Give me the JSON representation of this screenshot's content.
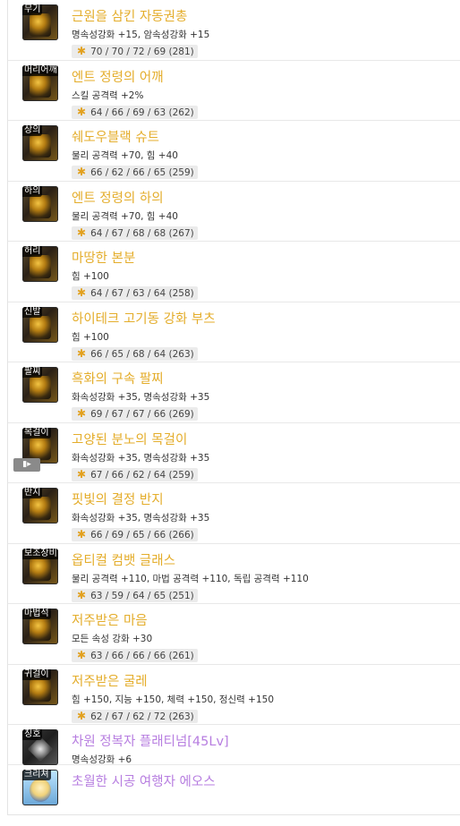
{
  "items": [
    {
      "slot": "무기",
      "name": "근원을 삼킨 자동권총",
      "option": "명속성강화 +15, 암속성강화 +15",
      "stats": "70 / 70 / 72 / 69 (281)",
      "color": "#e4ad2b",
      "icon": "pistol-icon"
    },
    {
      "slot": "머리어깨",
      "name": "엔트 정령의 어깨",
      "option": "스킬 공격력 +2%",
      "stats": "64 / 66 / 69 / 63 (262)",
      "color": "#e4ad2b",
      "icon": "shoulder-armor-icon"
    },
    {
      "slot": "상의",
      "name": "쉐도우블랙 슈트",
      "option": "물리 공격력 +70, 힘 +40",
      "stats": "66 / 62 / 66 / 65 (259)",
      "color": "#e4ad2b",
      "icon": "suit-icon"
    },
    {
      "slot": "하의",
      "name": "엔트 정령의 하의",
      "option": "물리 공격력 +70, 힘 +40",
      "stats": "64 / 67 / 68 / 68 (267)",
      "color": "#e4ad2b",
      "icon": "pants-icon"
    },
    {
      "slot": "허리",
      "name": "마땅한 본분",
      "option": "힘 +100",
      "stats": "64 / 67 / 63 / 64 (258)",
      "color": "#e4ad2b",
      "icon": "belt-icon"
    },
    {
      "slot": "신발",
      "name": "하이테크 고기동 강화 부츠",
      "option": "힘 +100",
      "stats": "66 / 65 / 68 / 64 (263)",
      "color": "#e4ad2b",
      "icon": "boots-icon"
    },
    {
      "slot": "팔찌",
      "name": "흑화의 구속 팔찌",
      "option": "화속성강화 +35, 명속성강화 +35",
      "stats": "69 / 67 / 67 / 66 (269)",
      "color": "#e4ad2b",
      "icon": "bracelet-icon"
    },
    {
      "slot": "목걸이",
      "name": "고양된 분노의 목걸이",
      "option": "화속성강화 +35, 명속성강화 +35",
      "stats": "67 / 66 / 62 / 64 (259)",
      "color": "#e4ad2b",
      "icon": "necklace-icon"
    },
    {
      "slot": "반지",
      "name": "핏빛의 결정 반지",
      "option": "화속성강화 +35, 명속성강화 +35",
      "stats": "66 / 69 / 65 / 66 (266)",
      "color": "#e4ad2b",
      "icon": "ring-icon"
    },
    {
      "slot": "보조장비",
      "name": "옵티컬 컴뱃 글래스",
      "option": "물리 공격력 +110, 마법 공격력 +110, 독립 공격력 +110",
      "stats": "63 / 59 / 64 / 65 (251)",
      "color": "#e4ad2b",
      "icon": "glasses-icon"
    },
    {
      "slot": "마법석",
      "name": "저주받은 마음",
      "option": "모든 속성 강화 +30",
      "stats": "63 / 66 / 66 / 66 (261)",
      "color": "#e4ad2b",
      "icon": "magic-stone-icon"
    },
    {
      "slot": "귀걸이",
      "name": "저주받은 굴레",
      "option": "힘 +150, 지능 +150, 체력 +150, 정신력 +150",
      "stats": "62 / 67 / 62 / 72 (263)",
      "color": "#e4ad2b",
      "icon": "earring-icon"
    },
    {
      "slot": "칭호",
      "name": "차원 정복자 플래티넘[45Lv]",
      "option": "명속성강화 +6",
      "stats": "",
      "color": "#b77ee0",
      "icon": "title-icon"
    },
    {
      "slot": "크리쳐",
      "name": "초월한 시공 여행자 에오스",
      "option": "",
      "stats": "",
      "color": "#b77ee0",
      "icon": "creature-icon"
    }
  ]
}
